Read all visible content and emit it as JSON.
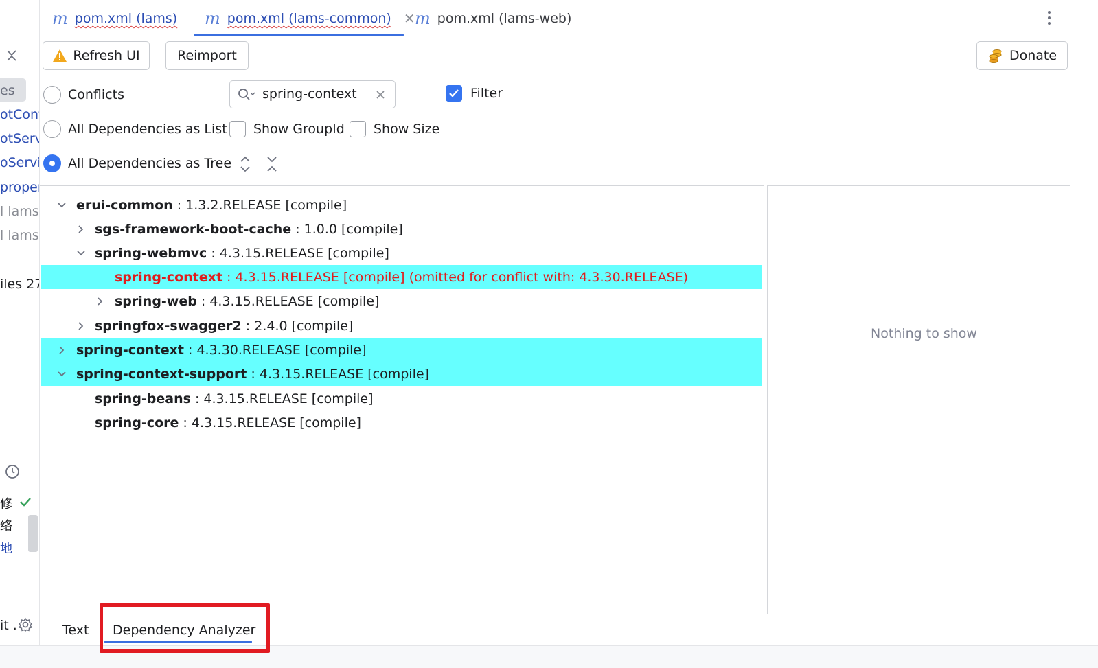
{
  "tabs": [
    {
      "label": "pom.xml (lams)",
      "active": false,
      "spell_error": true
    },
    {
      "label": "pom.xml (lams-common)",
      "active": true,
      "spell_error": true
    },
    {
      "label": "pom.xml (lams-web)",
      "active": false,
      "spell_error": false
    }
  ],
  "left_strip": {
    "items": [
      "es",
      "otCont",
      "otServi",
      "oServic",
      "proper",
      "l  lams",
      "l  lams",
      "iles  27"
    ],
    "bottom_items": [
      "修",
      "络",
      "地",
      ""
    ],
    "commit_label": "it ."
  },
  "toolbar": {
    "refresh_label": "Refresh UI",
    "reimport_label": "Reimport",
    "donate_label": "Donate"
  },
  "view_modes": {
    "conflicts_label": "Conflicts",
    "list_label": "All Dependencies as List",
    "tree_label": "All Dependencies as Tree",
    "selected": "All Dependencies as Tree"
  },
  "options": {
    "show_groupid_label": "Show GroupId",
    "show_groupid_checked": false,
    "show_size_label": "Show Size",
    "show_size_checked": false,
    "filter_label": "Filter",
    "filter_checked": true
  },
  "search": {
    "value": "spring-context"
  },
  "tree": [
    {
      "name": "erui-common",
      "detail": " : 1.3.2.RELEASE [compile]",
      "level": 0,
      "expander": "down",
      "highlight": false,
      "conflict": false
    },
    {
      "name": "sgs-framework-boot-cache",
      "detail": " : 1.0.0 [compile]",
      "level": 1,
      "expander": "right",
      "highlight": false,
      "conflict": false
    },
    {
      "name": "spring-webmvc",
      "detail": " : 4.3.15.RELEASE [compile]",
      "level": 1,
      "expander": "down",
      "highlight": false,
      "conflict": false
    },
    {
      "name": "spring-context",
      "detail": " : 4.3.15.RELEASE [compile] (omitted for conflict with: 4.3.30.RELEASE)",
      "level": 2,
      "expander": "none",
      "highlight": true,
      "conflict": true
    },
    {
      "name": "spring-web",
      "detail": " : 4.3.15.RELEASE [compile]",
      "level": 2,
      "expander": "right",
      "highlight": false,
      "conflict": false
    },
    {
      "name": "springfox-swagger2",
      "detail": " : 2.4.0 [compile]",
      "level": 1,
      "expander": "right",
      "highlight": false,
      "conflict": false
    },
    {
      "name": "spring-context",
      "detail": " : 4.3.30.RELEASE [compile]",
      "level": 0,
      "expander": "right",
      "highlight": true,
      "conflict": false
    },
    {
      "name": "spring-context-support",
      "detail": " : 4.3.15.RELEASE [compile]",
      "level": 0,
      "expander": "down",
      "highlight": true,
      "conflict": false
    },
    {
      "name": "spring-beans",
      "detail": " : 4.3.15.RELEASE [compile]",
      "level": 1,
      "expander": "none",
      "highlight": false,
      "conflict": false
    },
    {
      "name": "spring-core",
      "detail": " : 4.3.15.RELEASE [compile]",
      "level": 1,
      "expander": "none",
      "highlight": false,
      "conflict": false
    }
  ],
  "detail_panel": {
    "empty_text": "Nothing to show"
  },
  "bottom_tabs": [
    {
      "label": "Text",
      "active": false
    },
    {
      "label": "Dependency Analyzer",
      "active": true
    }
  ],
  "colors": {
    "accent": "#3574f0",
    "highlight_row": "#66ffff",
    "conflict_text": "#e11d1d",
    "annotation_box": "#e11b22"
  }
}
